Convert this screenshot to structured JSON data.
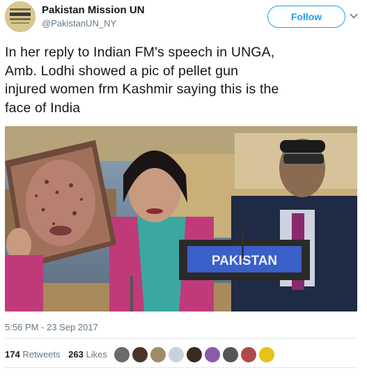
{
  "account": {
    "name": "Pakistan Mission UN",
    "handle": "@PakistanUN_NY",
    "avatar_text": "PERMANENT MISSION OF PAKISTAN TO THE UNITED NATIONS"
  },
  "follow_label": "Follow",
  "tweet": {
    "lines": [
      "In her reply to Indian FM's speech in UNGA,",
      "Amb. Lodhi showed a pic of pellet gun",
      "injured women frm Kashmir saying this is the",
      "face of India"
    ]
  },
  "photo": {
    "nameplate": "PAKISTAN"
  },
  "timestamp": "5:56 PM - 23 Sep 2017",
  "stats": {
    "retweets_count": "174",
    "retweets_label": "Retweets",
    "likes_count": "263",
    "likes_label": "Likes"
  },
  "likers": [
    {
      "icon": "liker-avatar-1",
      "color": "#6b6b6b"
    },
    {
      "icon": "liker-avatar-2",
      "color": "#4a3426"
    },
    {
      "icon": "liker-avatar-3",
      "color": "#a08a6a"
    },
    {
      "icon": "liker-avatar-4",
      "color": "#c9d3dd"
    },
    {
      "icon": "liker-avatar-5",
      "color": "#3a2a20"
    },
    {
      "icon": "liker-avatar-6",
      "color": "#8a5aa8"
    },
    {
      "icon": "liker-avatar-7",
      "color": "#555555"
    },
    {
      "icon": "liker-avatar-8",
      "color": "#b04a4a"
    },
    {
      "icon": "liker-avatar-9",
      "color": "#e8c21a"
    }
  ],
  "colors": {
    "accent": "#1da1f2",
    "secondary_text": "#657786",
    "nameplate_blue": "#3a5fc8"
  }
}
